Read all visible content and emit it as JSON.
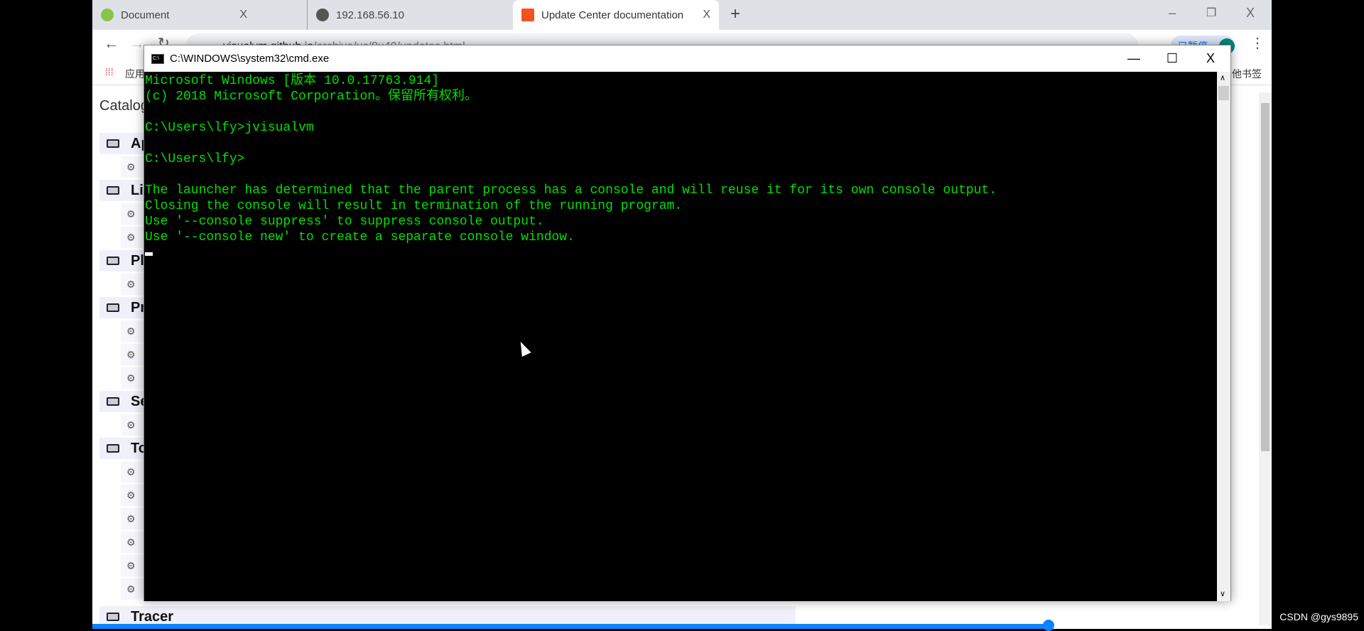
{
  "browser": {
    "tabs": [
      {
        "label": "Document",
        "active": false
      },
      {
        "label": "192.168.56.10",
        "active": false
      },
      {
        "label": "Update Center documentation",
        "active": true
      }
    ],
    "tab_close": "X",
    "new_tab": "+",
    "url_host": "visualvm.github.io",
    "url_path": "/archive/uc/8u40/updates.html",
    "profile_label": "已暂停",
    "bookmarks_apps": "应用",
    "bookmarks_other": "其他书签",
    "window_controls": {
      "minimize": "–",
      "restore": "❐",
      "close": "X"
    }
  },
  "page": {
    "catalog_title": "Catalog",
    "groups": [
      {
        "label": "Ap",
        "items": 1
      },
      {
        "label": "Lib",
        "items": 2
      },
      {
        "label": "Pla",
        "items": 1
      },
      {
        "label": "Pro",
        "items": 3
      },
      {
        "label": "Sec",
        "items": 1
      },
      {
        "label": "Too",
        "items": 6
      },
      {
        "label": "Tracer",
        "items": 0
      }
    ]
  },
  "cmd": {
    "title": "C:\\WINDOWS\\system32\\cmd.exe",
    "controls": {
      "minimize": "—",
      "maximize": "☐",
      "close": "X"
    },
    "lines": [
      "Microsoft Windows [版本 10.0.17763.914]",
      "(c) 2018 Microsoft Corporation。保留所有权利。",
      "",
      "C:\\Users\\lfy>jvisualvm",
      "",
      "C:\\Users\\lfy>",
      "",
      "The launcher has determined that the parent process has a console and will reuse it for its own console output.",
      "Closing the console will result in termination of the running program.",
      "Use '--console suppress' to suppress console output.",
      "Use '--console new' to create a separate console window.",
      ""
    ],
    "text_color": "#00e000"
  },
  "watermark": "CSDN @gys9895"
}
